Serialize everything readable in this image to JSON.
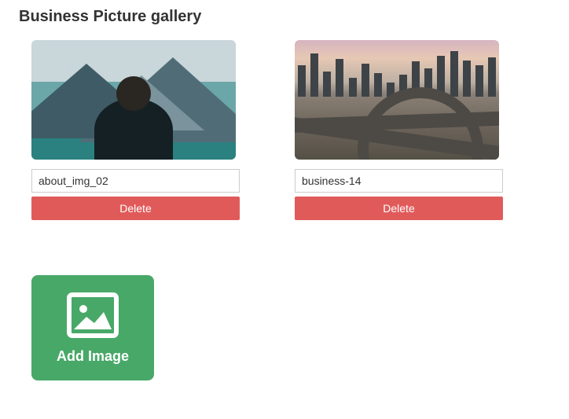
{
  "title": "Business Picture gallery",
  "gallery": [
    {
      "filename": "about_img_02",
      "delete_label": "Delete"
    },
    {
      "filename": "business-14",
      "delete_label": "Delete"
    }
  ],
  "add_image_label": "Add Image"
}
